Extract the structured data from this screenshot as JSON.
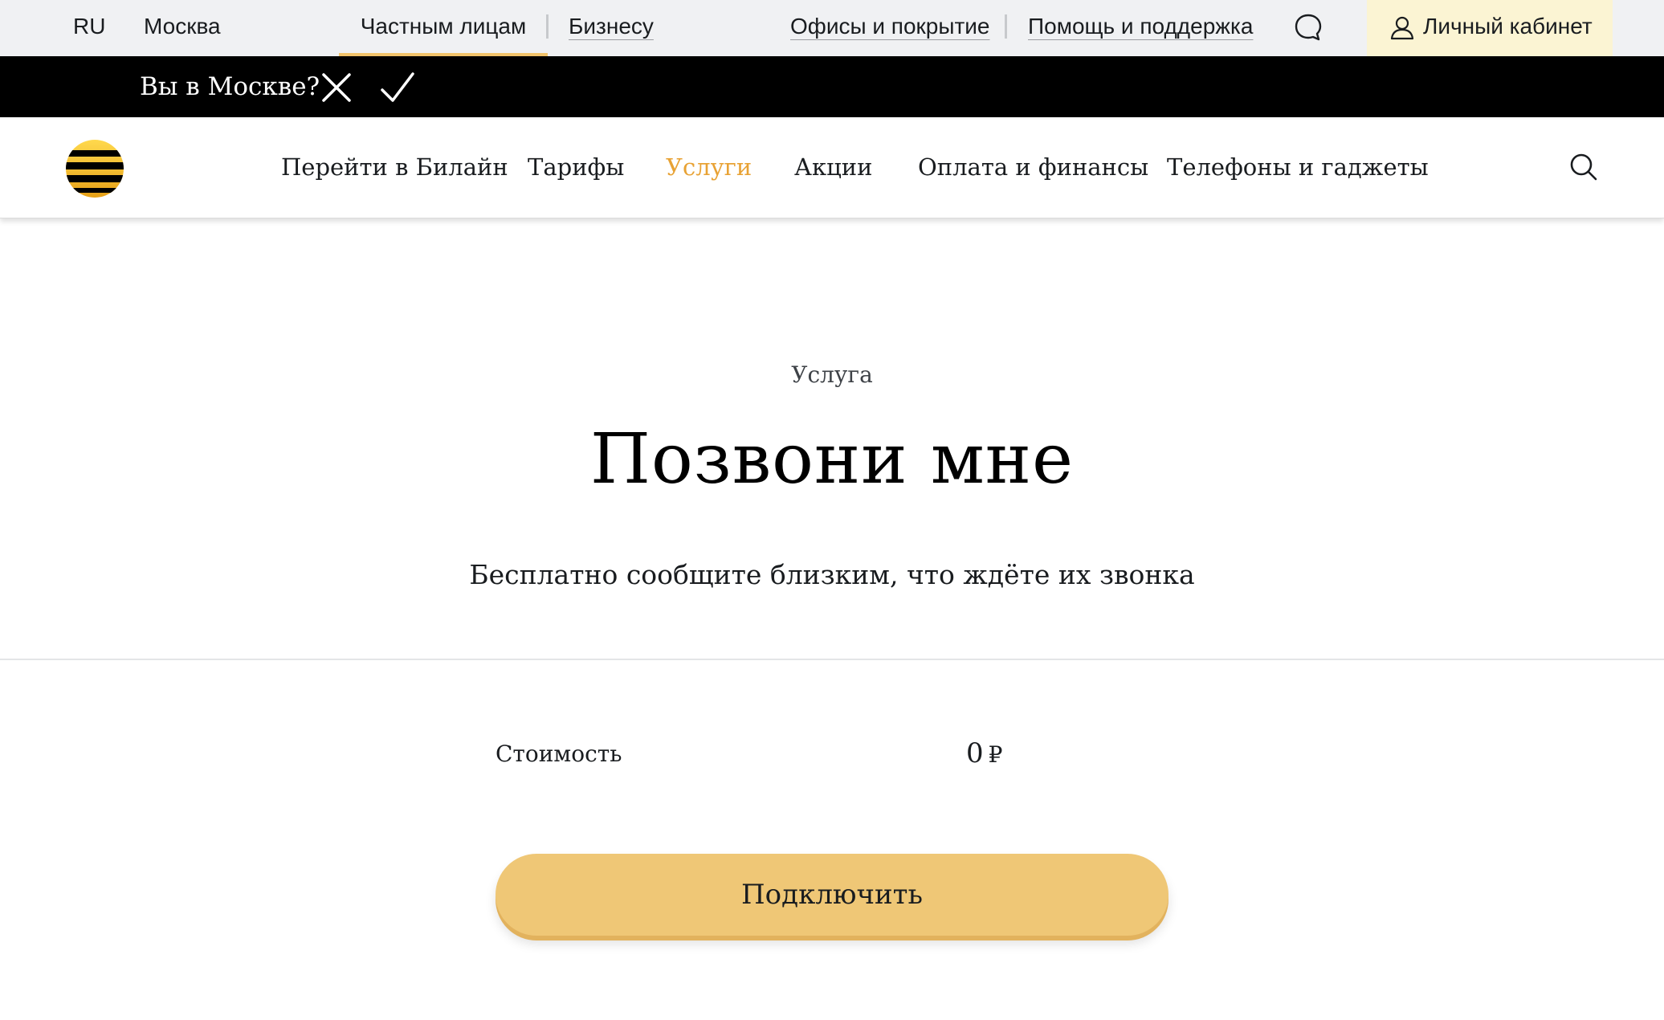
{
  "topbar": {
    "language": "RU",
    "city": "Москва",
    "segments": [
      "Частным лицам",
      "Бизнесу"
    ],
    "links": [
      "Офисы и покрытие",
      "Помощь и поддержка"
    ],
    "chat_icon": "chat-bubble-icon",
    "cabinet_label": "Личный кабинет",
    "cabinet_icon": "user-icon"
  },
  "location_bar": {
    "question": "Вы в Москве?",
    "reject_icon": "close-icon",
    "confirm_icon": "check-icon"
  },
  "main_nav": {
    "logo_icon": "beeline-logo",
    "items": [
      "Перейти в Билайн",
      "Тарифы",
      "Услуги",
      "Акции",
      "Оплата и финансы",
      "Телефоны и гаджеты"
    ],
    "active_item": "Услуги",
    "search_icon": "search-icon"
  },
  "hero": {
    "eyebrow": "Услуга",
    "title": "Позвони мне",
    "subtitle": "Бесплатно сообщите близким, что ждёте их звонка"
  },
  "price": {
    "label": "Стоимость",
    "value": "0",
    "currency": "₽"
  },
  "cta": {
    "label": "Подключить"
  },
  "colors": {
    "accent": "#e8a234",
    "button": "#efc776",
    "topbar_bg": "#f0f1f3",
    "cabinet_bg": "#fbf4d3",
    "location_bar_bg": "#000000"
  }
}
